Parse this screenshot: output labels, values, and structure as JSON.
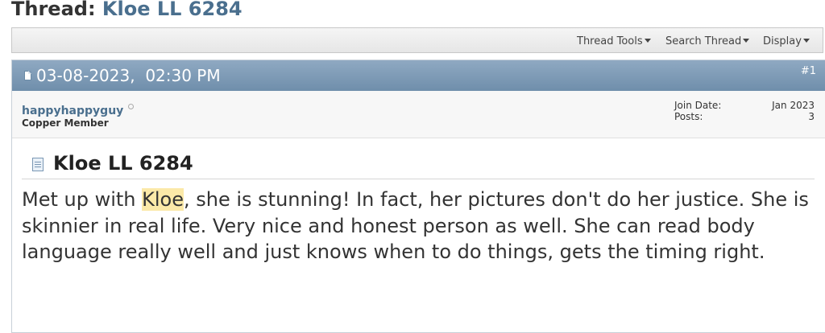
{
  "thread": {
    "label": "Thread:",
    "title": "Kloe LL 6284"
  },
  "toolbar": {
    "thread_tools": "Thread Tools",
    "search_thread": "Search Thread",
    "display": "Display"
  },
  "post": {
    "date": "03-08-2023,",
    "time": "02:30 PM",
    "number": "#1",
    "user": {
      "username": "happyhappyguy",
      "title": "Copper Member",
      "join_date_label": "Join Date:",
      "join_date": "Jan 2023",
      "posts_label": "Posts:",
      "posts": "3"
    },
    "title": "Kloe LL 6284",
    "body": {
      "prefix": "Met up with ",
      "highlight": "Kloe",
      "rest": ", she is stunning! In fact, her pictures don't do her justice. She is skinnier in real life. Very nice and honest person as well. She can read body language really well and just knows when to do things, gets the timing right."
    }
  }
}
